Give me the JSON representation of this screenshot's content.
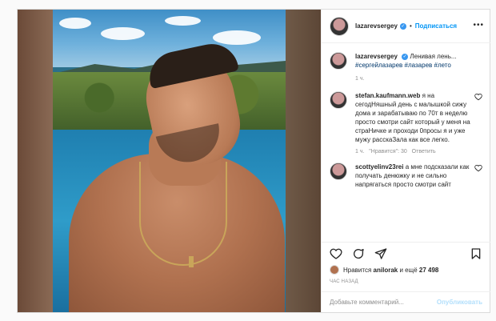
{
  "post": {
    "author": "lazarevsergey",
    "follow_label": "Подписаться",
    "dot": "•",
    "more_label": "•••"
  },
  "caption": {
    "author": "lazarevsergey",
    "text": "Ленивая лень...",
    "hashtags": "#сергейлазарев #лазарев #лето",
    "time": "1 ч."
  },
  "comments": [
    {
      "author": "stefan.kaufmann.web",
      "text": "я на сегодНяшный день с малышкой сижу дома и зарабатываю по 70т в неделю просто смотри сайт который у меня на страНичке и проходи 0просы я и уже мужу расскаЗала как все легко.",
      "time": "1 ч.",
      "likes": "\"Нравится\": 30",
      "reply": "Ответить"
    },
    {
      "author": "scottyelinv23rei",
      "text": "а мне подсказали как получать денюжку и не сильно напрягаться просто смотри сайт",
      "time": "",
      "likes": "",
      "reply": ""
    }
  ],
  "likes": {
    "prefix": "Нравится",
    "user": "anilorak",
    "suffix": "и ещё",
    "count": "27 498"
  },
  "timestamp": "ЧАС НАЗАД",
  "add_comment": {
    "placeholder": "Добавьте комментарий...",
    "publish_label": "Опубликовать"
  },
  "colors": {
    "accent": "#0095f6",
    "verified": "#3897f0",
    "hashtag": "#00376b"
  }
}
